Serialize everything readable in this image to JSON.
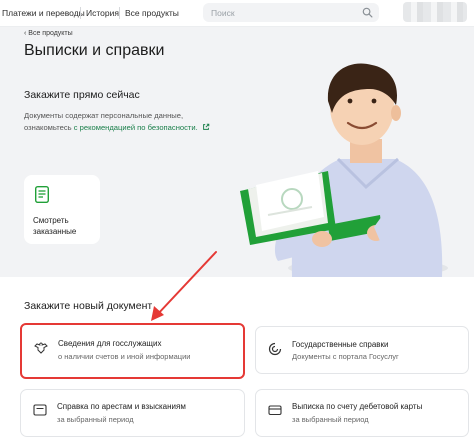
{
  "nav": {
    "items": [
      "Платежи и переводы",
      "История",
      "Все продукты"
    ],
    "search_placeholder": "Поиск"
  },
  "hero": {
    "back_link": "Все продукты",
    "title": "Выписки и справки",
    "subtitle": "Закажите прямо сейчас",
    "desc_text": "Документы содержат персональные данные, ознакомьтесь ",
    "desc_link": "с рекомендацией по безопасности.",
    "order_card": {
      "line1": "Смотреть",
      "line2": "заказанные"
    }
  },
  "new_doc": {
    "title": "Закажите новый документ",
    "cards": [
      {
        "title": "Сведения для госслужащих",
        "subtitle": "о наличии счетов и иной информации",
        "icon": "eagle-icon"
      },
      {
        "title": "Государственные справки",
        "subtitle": "Документы с портала Госуслуг",
        "icon": "gosuslugi-icon"
      },
      {
        "title": "Справка по арестам и взысканиям",
        "subtitle": "за выбранный период",
        "icon": "document-icon"
      },
      {
        "title": "Выписка по счету дебетовой карты",
        "subtitle": "за выбранный период",
        "icon": "card-icon"
      }
    ]
  },
  "colors": {
    "accent_green": "#21a038",
    "highlight_red": "#e53935",
    "hero_bg": "#f2f3f5"
  }
}
